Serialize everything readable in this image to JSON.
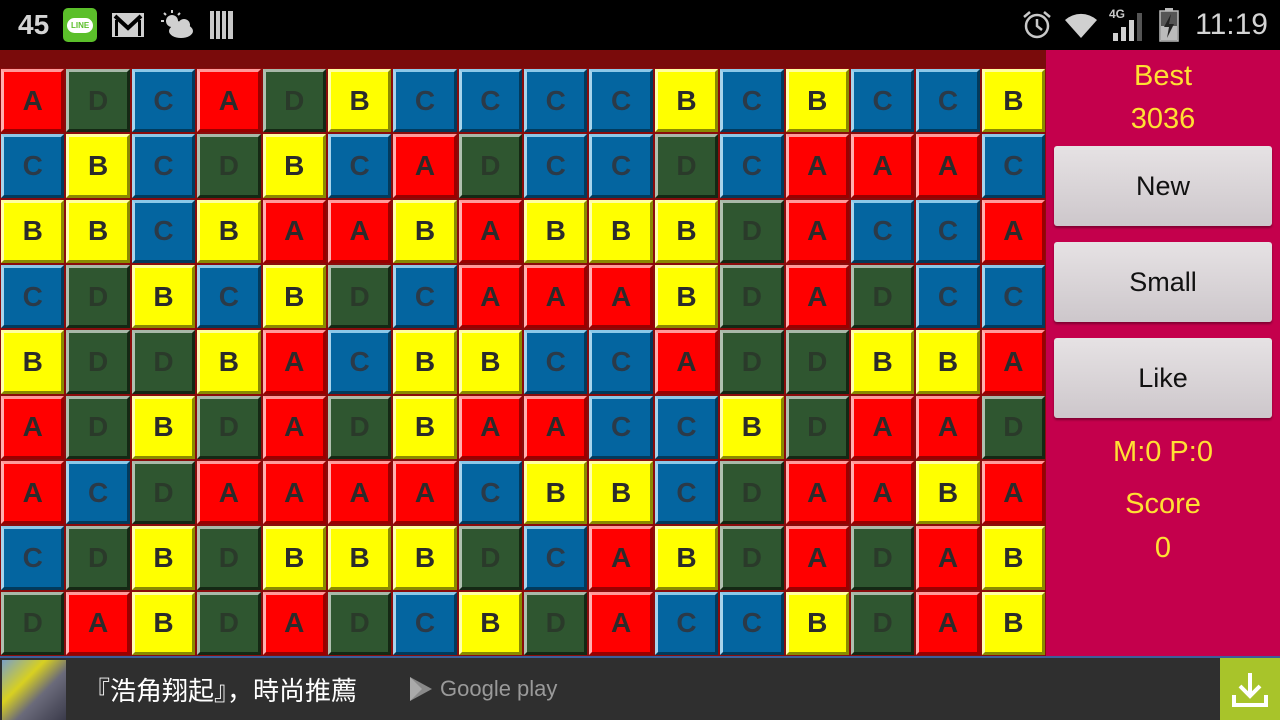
{
  "status_bar": {
    "left_number": "45",
    "notification_icons": [
      "line-app-icon",
      "gmail-icon",
      "weather-partly-cloudy-icon",
      "barcode-icon"
    ],
    "line_label": "LINE",
    "right_icons": [
      "alarm-icon",
      "wifi-icon",
      "signal-4g-icon",
      "battery-charging-icon"
    ],
    "network": "4G",
    "time": "11:19"
  },
  "game": {
    "rows": 9,
    "cols": 16,
    "colors": {
      "A": "#ff0000",
      "B": "#ffff00",
      "C": "#0465a0",
      "D": "#2f5630"
    },
    "grid": [
      [
        "A",
        "D",
        "C",
        "A",
        "D",
        "B",
        "C",
        "C",
        "C",
        "C",
        "B",
        "C",
        "B",
        "C",
        "C",
        "B"
      ],
      [
        "C",
        "B",
        "C",
        "D",
        "B",
        "C",
        "A",
        "D",
        "C",
        "C",
        "D",
        "C",
        "A",
        "A",
        "A",
        "C"
      ],
      [
        "B",
        "B",
        "C",
        "B",
        "A",
        "A",
        "B",
        "A",
        "B",
        "B",
        "B",
        "D",
        "A",
        "C",
        "C",
        "A"
      ],
      [
        "C",
        "D",
        "B",
        "C",
        "B",
        "D",
        "C",
        "A",
        "A",
        "A",
        "B",
        "D",
        "A",
        "D",
        "C",
        "C"
      ],
      [
        "B",
        "D",
        "D",
        "B",
        "A",
        "C",
        "B",
        "B",
        "C",
        "C",
        "A",
        "D",
        "D",
        "B",
        "B",
        "A"
      ],
      [
        "A",
        "D",
        "B",
        "D",
        "A",
        "D",
        "B",
        "A",
        "A",
        "C",
        "C",
        "B",
        "D",
        "A",
        "A",
        "D"
      ],
      [
        "A",
        "C",
        "D",
        "A",
        "A",
        "A",
        "A",
        "C",
        "B",
        "B",
        "C",
        "D",
        "A",
        "A",
        "B",
        "A"
      ],
      [
        "C",
        "D",
        "B",
        "D",
        "B",
        "B",
        "B",
        "D",
        "C",
        "A",
        "B",
        "D",
        "A",
        "D",
        "A",
        "B"
      ],
      [
        "D",
        "A",
        "B",
        "D",
        "A",
        "D",
        "C",
        "B",
        "D",
        "A",
        "C",
        "C",
        "B",
        "D",
        "A",
        "B"
      ]
    ]
  },
  "side_panel": {
    "best_label": "Best",
    "best_value": "3036",
    "buttons": {
      "new": "New",
      "small": "Small",
      "like": "Like"
    },
    "moves_text": "M:0 P:0",
    "score_label": "Score",
    "score_value": "0",
    "background": "#c4004c",
    "text_color": "#ffe033"
  },
  "ad_banner": {
    "text": "『浩角翔起』，時尚推薦",
    "store_label": "Google play",
    "download_icon": "download-icon"
  }
}
